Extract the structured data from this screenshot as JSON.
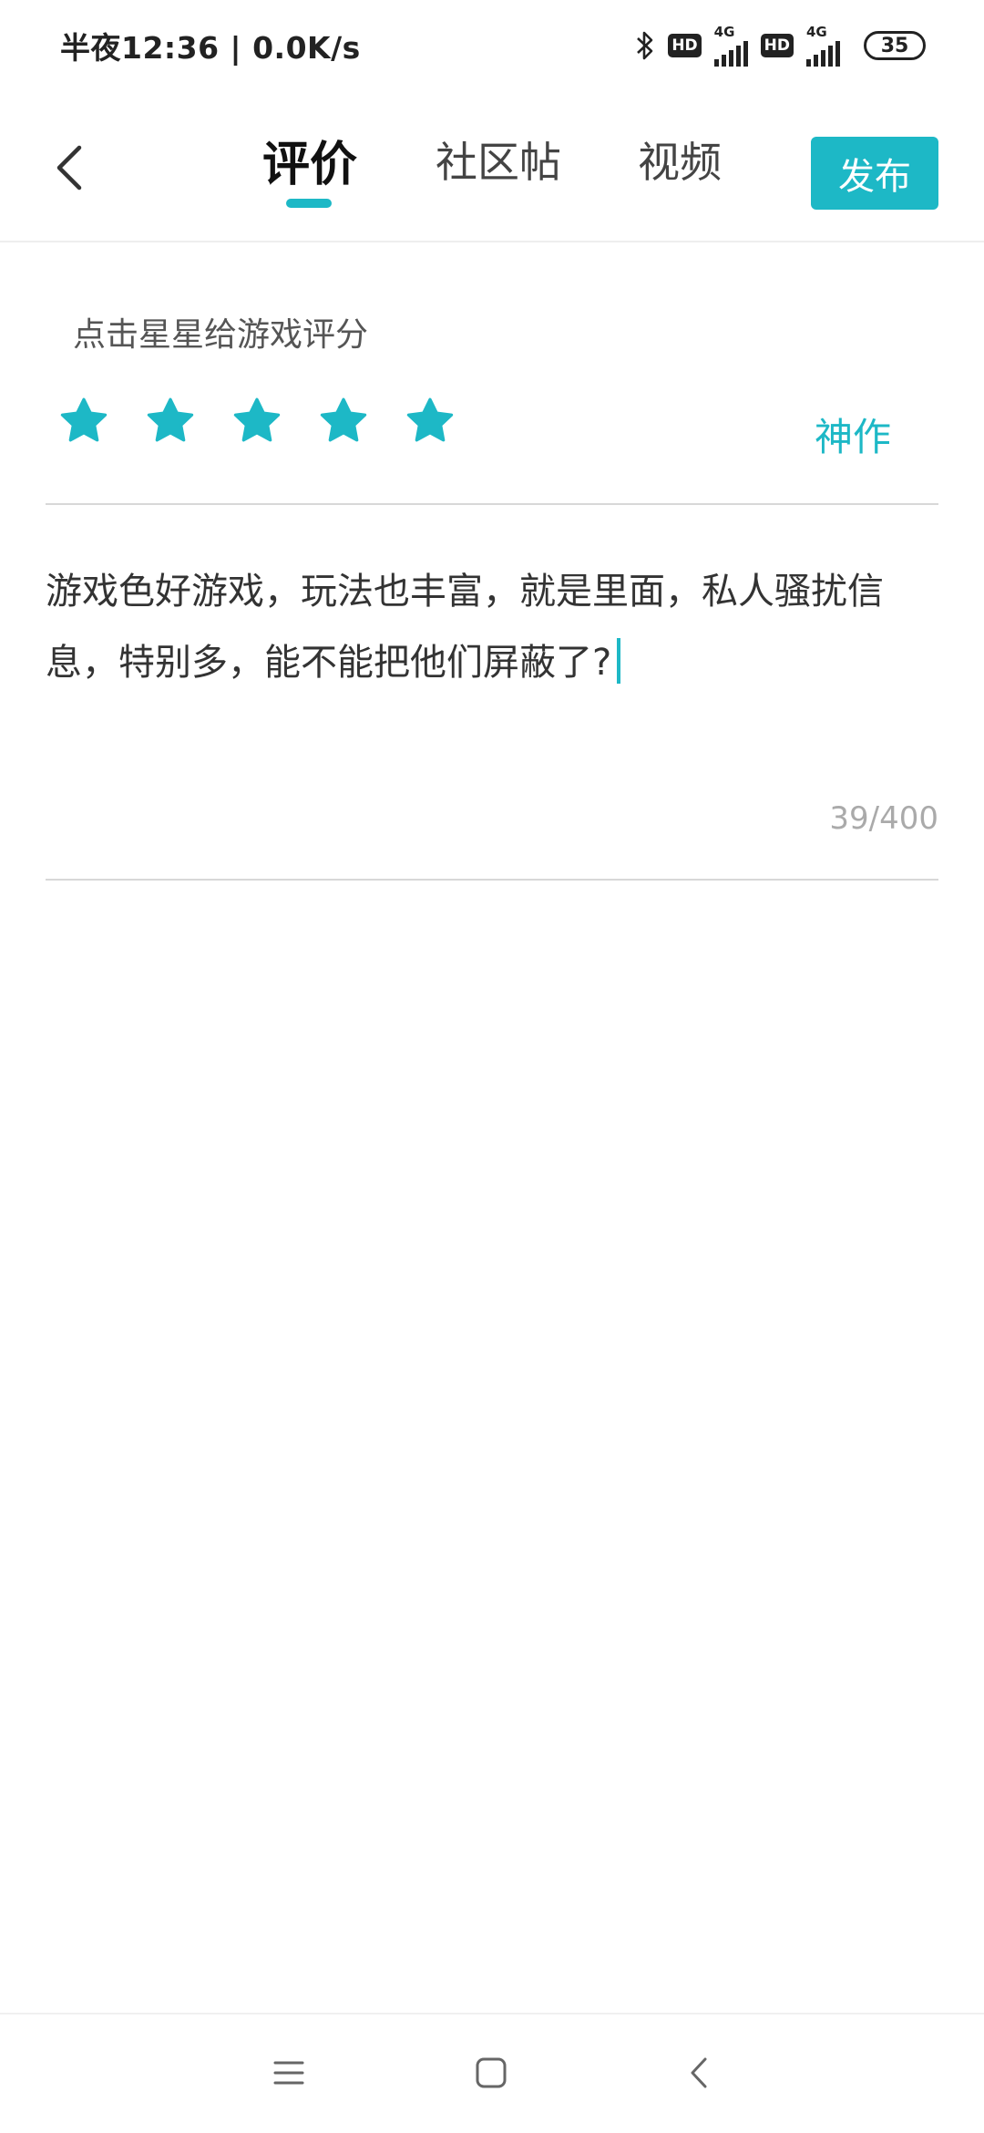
{
  "status_bar": {
    "time_speed": "半夜12:36 | 0.0K/s",
    "hd_label": "HD",
    "network_label": "4G",
    "battery_level": "35"
  },
  "header": {
    "tabs": [
      {
        "label": "评价",
        "active": true
      },
      {
        "label": "社区帖",
        "active": false
      },
      {
        "label": "视频",
        "active": false
      }
    ],
    "publish_label": "发布"
  },
  "rating": {
    "hint": "点击星星给游戏评分",
    "stars_selected": 5,
    "stars_total": 5,
    "rating_word": "神作"
  },
  "review": {
    "text": "游戏色好游戏，玩法也丰富，就是里面，私人骚扰信息，特别多，能不能把他们屏蔽了?",
    "char_count": "39/400"
  },
  "icons": {
    "back": "chevron-left-icon",
    "star": "star-icon",
    "bluetooth": "bluetooth-icon",
    "nav_menu": "menu-icon",
    "nav_home": "home-icon",
    "nav_back": "back-icon"
  },
  "colors": {
    "accent": "#1db8c6",
    "text": "#333333",
    "muted": "#aaaaaa"
  }
}
